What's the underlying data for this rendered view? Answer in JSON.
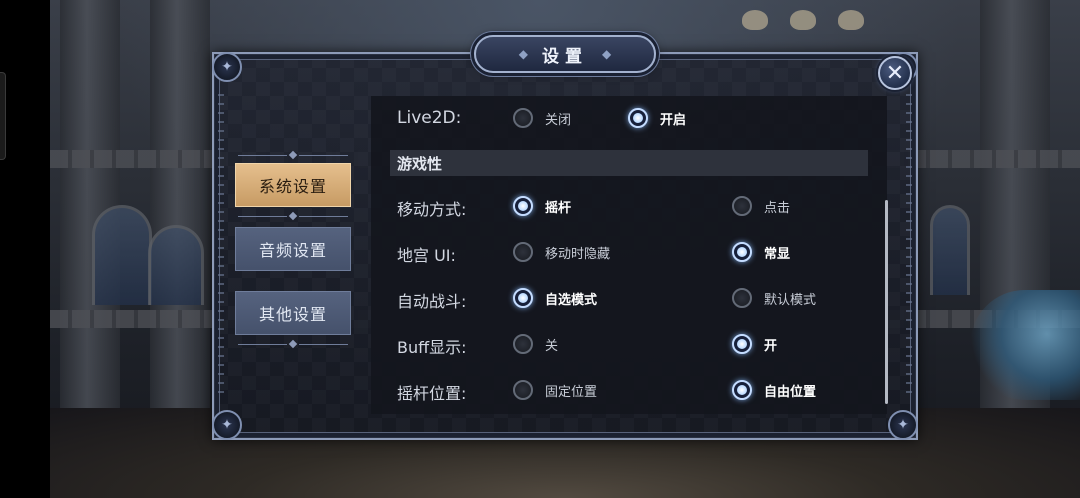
{
  "dialog": {
    "title": "设置",
    "close_icon": "close-x-icon"
  },
  "tabs": [
    {
      "label": "系统设置",
      "active": true
    },
    {
      "label": "音频设置",
      "active": false
    },
    {
      "label": "其他设置",
      "active": false
    }
  ],
  "settings": {
    "live2d": {
      "label": "Live2D:",
      "options": [
        "关闭",
        "开启"
      ],
      "selected": 1
    },
    "section_title": "游戏性",
    "move_mode": {
      "label": "移动方式:",
      "options": [
        "摇杆",
        "点击"
      ],
      "selected": 0
    },
    "dungeon_ui": {
      "label": "地宫 UI:",
      "options": [
        "移动时隐藏",
        "常显"
      ],
      "selected": 1
    },
    "auto_battle": {
      "label": "自动战斗:",
      "options": [
        "自选模式",
        "默认模式"
      ],
      "selected": 0
    },
    "buff_display": {
      "label": "Buff显示:",
      "options": [
        "关",
        "开"
      ],
      "selected": 1
    },
    "joystick_pos": {
      "label": "摇杆位置:",
      "options": [
        "固定位置",
        "自由位置"
      ],
      "selected": 1
    }
  },
  "colors": {
    "tab_active": "#d8ad78",
    "tab_inactive": "#4f5b76",
    "radio_on_glow": "#b8d8ff"
  }
}
